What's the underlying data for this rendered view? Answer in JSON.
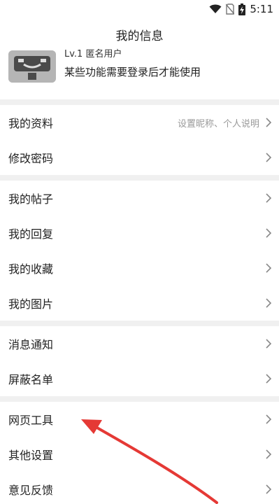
{
  "status_bar": {
    "time": "5:11"
  },
  "header": {
    "title": "我的信息"
  },
  "profile": {
    "level": "Lv.1 匿名用户",
    "login_hint": "某些功能需要登录后才能使用"
  },
  "sections": [
    [
      {
        "label": "我的资料",
        "sub": "设置昵称、个人说明"
      },
      {
        "label": "修改密码",
        "sub": ""
      }
    ],
    [
      {
        "label": "我的帖子",
        "sub": ""
      },
      {
        "label": "我的回复",
        "sub": ""
      },
      {
        "label": "我的收藏",
        "sub": ""
      },
      {
        "label": "我的图片",
        "sub": ""
      }
    ],
    [
      {
        "label": "消息通知",
        "sub": ""
      },
      {
        "label": "屏蔽名单",
        "sub": ""
      }
    ],
    [
      {
        "label": "网页工具",
        "sub": ""
      },
      {
        "label": "其他设置",
        "sub": ""
      },
      {
        "label": "意见反馈",
        "sub": ""
      }
    ]
  ],
  "colors": {
    "accent_arrow": "#e53935",
    "section_gap": "#f0f0f0",
    "secondary_text": "#999999"
  },
  "icons": [
    "wifi-icon",
    "no-sim-icon",
    "battery-icon",
    "chevron-right-icon",
    "avatar-placeholder"
  ]
}
